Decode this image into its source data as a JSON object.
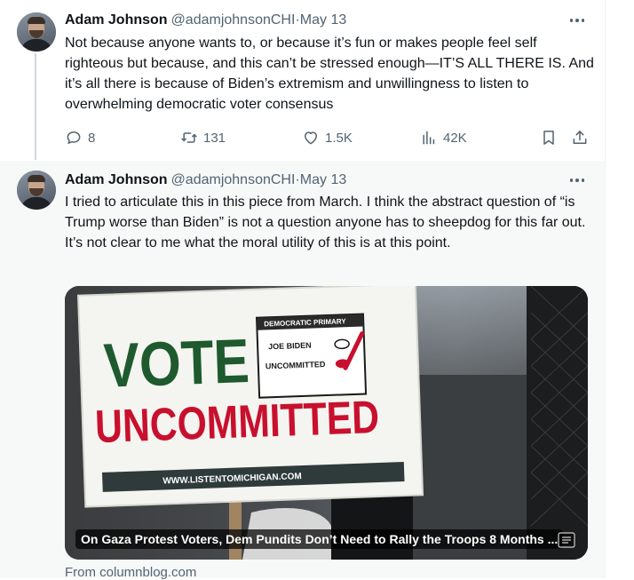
{
  "tweets": [
    {
      "author_name": "Adam Johnson",
      "handle": "@adamjohnsonCHI",
      "separator": " · ",
      "date": "May 13",
      "text": "Not because anyone wants to, or because it’s fun or makes people feel self righteous but because, and this can’t be stressed enough—IT’S ALL THERE IS. And it’s all there is because of Biden’s extremism and unwillingness to listen to overwhelming democratic voter consensus",
      "replies": "8",
      "reposts": "131",
      "likes": "1.5K",
      "views": "42K"
    },
    {
      "author_name": "Adam Johnson",
      "handle": "@adamjohnsonCHI",
      "separator": " · ",
      "date": "May 13",
      "text": "I tried to articulate this in this piece from March. I think the abstract question of “is Trump worse than Biden” is not a question anyone has to sheepdog for this far out. It’s not clear to me what the moral utility of this is at this point.",
      "card": {
        "title": "On Gaza Protest Voters, Dem Pundits Don’t Need to Rally the Troops 8 Months ...",
        "source": "From columnblog.com",
        "sign": {
          "line1": "VOTE",
          "line2": "UNCOMMITTED",
          "box_header": "DEMOCRATIC PRIMARY",
          "option1": "JOE BIDEN",
          "option2": "UNCOMMITTED",
          "url": "WWW.LISTENTOMICHIGAN.COM"
        }
      }
    }
  ],
  "colors": {
    "text_primary": "#0f1419",
    "text_secondary": "#536471",
    "thread_line": "#cfd9de",
    "sign_green": "#1e5a2e",
    "sign_red": "#c8102e"
  },
  "icons": {
    "reply": "speech-bubble",
    "repost": "arrows-loop",
    "like": "heart",
    "views": "bar-chart",
    "bookmark": "bookmark",
    "share": "upload-arrow",
    "more": "three-dots"
  }
}
